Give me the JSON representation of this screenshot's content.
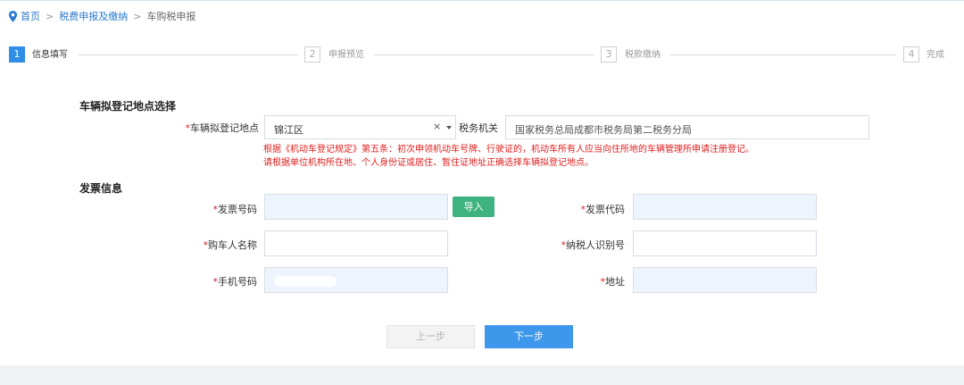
{
  "breadcrumb": {
    "home": "首页",
    "section": "税费申报及缴纳",
    "current": "车购税申报",
    "separator": ">"
  },
  "steps": [
    {
      "num": "1",
      "label": "信息填写",
      "active": true
    },
    {
      "num": "2",
      "label": "申报预览",
      "active": false
    },
    {
      "num": "3",
      "label": "税款缴纳",
      "active": false
    },
    {
      "num": "4",
      "label": "完成",
      "active": false
    }
  ],
  "location_section": {
    "title": "车辆拟登记地点选择",
    "location_label": "车辆拟登记地点",
    "location_value": "锦江区",
    "clear_symbol": "×",
    "tax_office_label": "税务机关",
    "tax_office_value": "国家税务总局成都市税务局第二税务分局",
    "notice_line1": "根据《机动车登记规定》第五条：初次申领机动车号牌、行驶证的，机动车所有人应当向住所地的车辆管理所申请注册登记。",
    "notice_line2": "请根据单位机构所在地、个人身份证或居住、暂住证地址正确选择车辆拟登记地点。"
  },
  "invoice_section": {
    "title": "发票信息",
    "required_mark": "*",
    "invoice_number_label": "发票号码",
    "invoice_number_value": "",
    "import_button": "导入",
    "invoice_code_label": "发票代码",
    "invoice_code_value": "",
    "buyer_name_label": "购车人名称",
    "buyer_name_value": "",
    "taxpayer_id_label": "纳税人识别号",
    "taxpayer_id_value": "",
    "phone_label": "手机号码",
    "phone_value": "",
    "address_label": "地址",
    "address_value": ""
  },
  "buttons": {
    "prev": "上一步",
    "next": "下一步"
  },
  "colors": {
    "accent": "#2e8de4",
    "link": "#2a7ad0",
    "import_green": "#3fb37f",
    "notice_red": "#e02020"
  },
  "icons": {
    "home": "location-pin-icon",
    "select_caret": "caret-down-icon",
    "clear": "clear-icon"
  }
}
